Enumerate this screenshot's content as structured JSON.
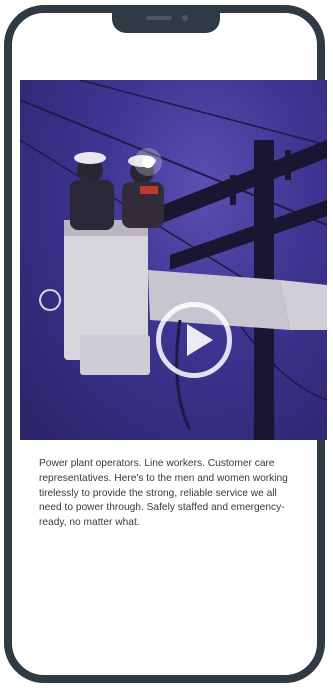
{
  "caption": "Power plant operators. Line workers. Customer care representatives. Here's to the men and women working tirelessly to provide the strong, reliable service we all need to power through. Safely staffed and emergency-ready, no matter what."
}
